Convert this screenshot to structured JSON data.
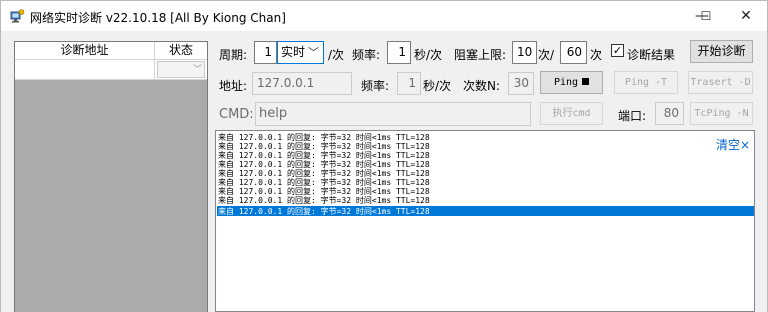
{
  "window": {
    "title": "网络实时诊断 v22.10.18 [All By Kiong Chan]",
    "minimize_glyph": "—",
    "maximize_glyph": "☐",
    "close_glyph": "✕"
  },
  "address_list": {
    "col_address": "诊断地址",
    "col_status": "状态",
    "status_dropdown_glyph": "﹀"
  },
  "row1": {
    "period_label": "周期:",
    "period_value": "1",
    "period_unit_selected": "实时",
    "per_time_label": "/次",
    "frequency_label": "频率:",
    "frequency_value": "1",
    "frequency_unit": "秒/次",
    "block_limit_label": "阻塞上限:",
    "block_limit_count": "10",
    "block_limit_slash": "次/",
    "block_limit_value": "60",
    "block_limit_unit": "次",
    "diag_result_checked": true,
    "diag_result_label": "诊断结果",
    "start_button": "开始诊断"
  },
  "row2": {
    "address_label": "地址:",
    "address_value": "127.0.0.1",
    "frequency_label": "频率:",
    "frequency_value": "1",
    "frequency_unit": "秒/次",
    "count_label": "次数N:",
    "count_value": "30",
    "ping_button": "Ping",
    "ping_t_button": "Ping -T",
    "tracert_button": "Trasert -D"
  },
  "row3": {
    "cmd_label": "CMD:",
    "cmd_value": "help",
    "exec_button": "执行cmd",
    "port_label": "端口:",
    "port_value": "80",
    "tcping_button": "TcPing -N"
  },
  "output": {
    "clear_label": "清空×",
    "lines": [
      "来自 127.0.0.1 的回复: 字节=32 时间<1ms TTL=128",
      "来自 127.0.0.1 的回复: 字节=32 时间<1ms TTL=128",
      "来自 127.0.0.1 的回复: 字节=32 时间<1ms TTL=128",
      "来自 127.0.0.1 的回复: 字节=32 时间<1ms TTL=128",
      "来自 127.0.0.1 的回复: 字节=32 时间<1ms TTL=128",
      "来自 127.0.0.1 的回复: 字节=32 时间<1ms TTL=128",
      "来自 127.0.0.1 的回复: 字节=32 时间<1ms TTL=128",
      "来自 127.0.0.1 的回复: 字节=32 时间<1ms TTL=128",
      "来自 127.0.0.1 的回复: 字节=32 时间<1ms TTL=128"
    ],
    "selected_line_index": 8
  },
  "colors": {
    "accent": "#0078d7",
    "link": "#0066cc",
    "list_background": "#ababab"
  }
}
